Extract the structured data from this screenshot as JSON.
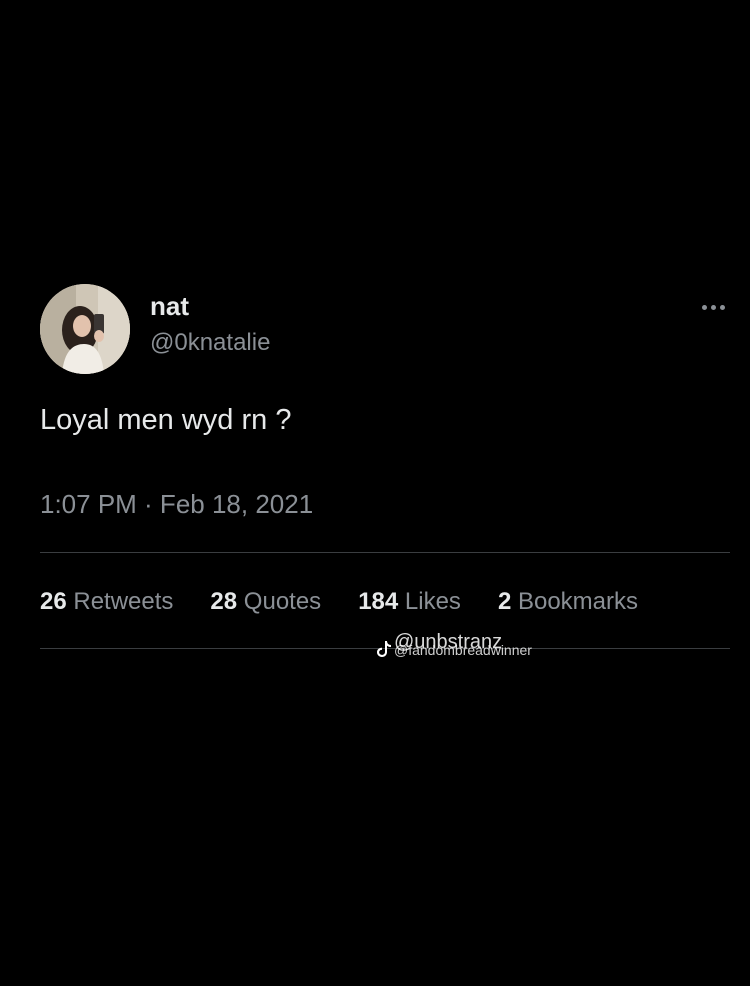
{
  "tweet": {
    "author": {
      "display_name": "nat",
      "handle": "@0knatalie"
    },
    "text": "Loyal men wyd rn ?",
    "timestamp": "1:07 PM · Feb 18, 2021",
    "stats": [
      {
        "count": "26",
        "label": "Retweets"
      },
      {
        "count": "28",
        "label": "Quotes"
      },
      {
        "count": "184",
        "label": "Likes"
      },
      {
        "count": "2",
        "label": "Bookmarks"
      }
    ]
  },
  "watermark": {
    "icon": "tiktok-icon",
    "handle_main": "@unbstranz",
    "handle_sub": "@fandombreadwinner"
  },
  "colors": {
    "background": "#000000",
    "primary_text": "#e7e9ea",
    "secondary_text": "#8b9096",
    "divider": "#3a3d40"
  }
}
